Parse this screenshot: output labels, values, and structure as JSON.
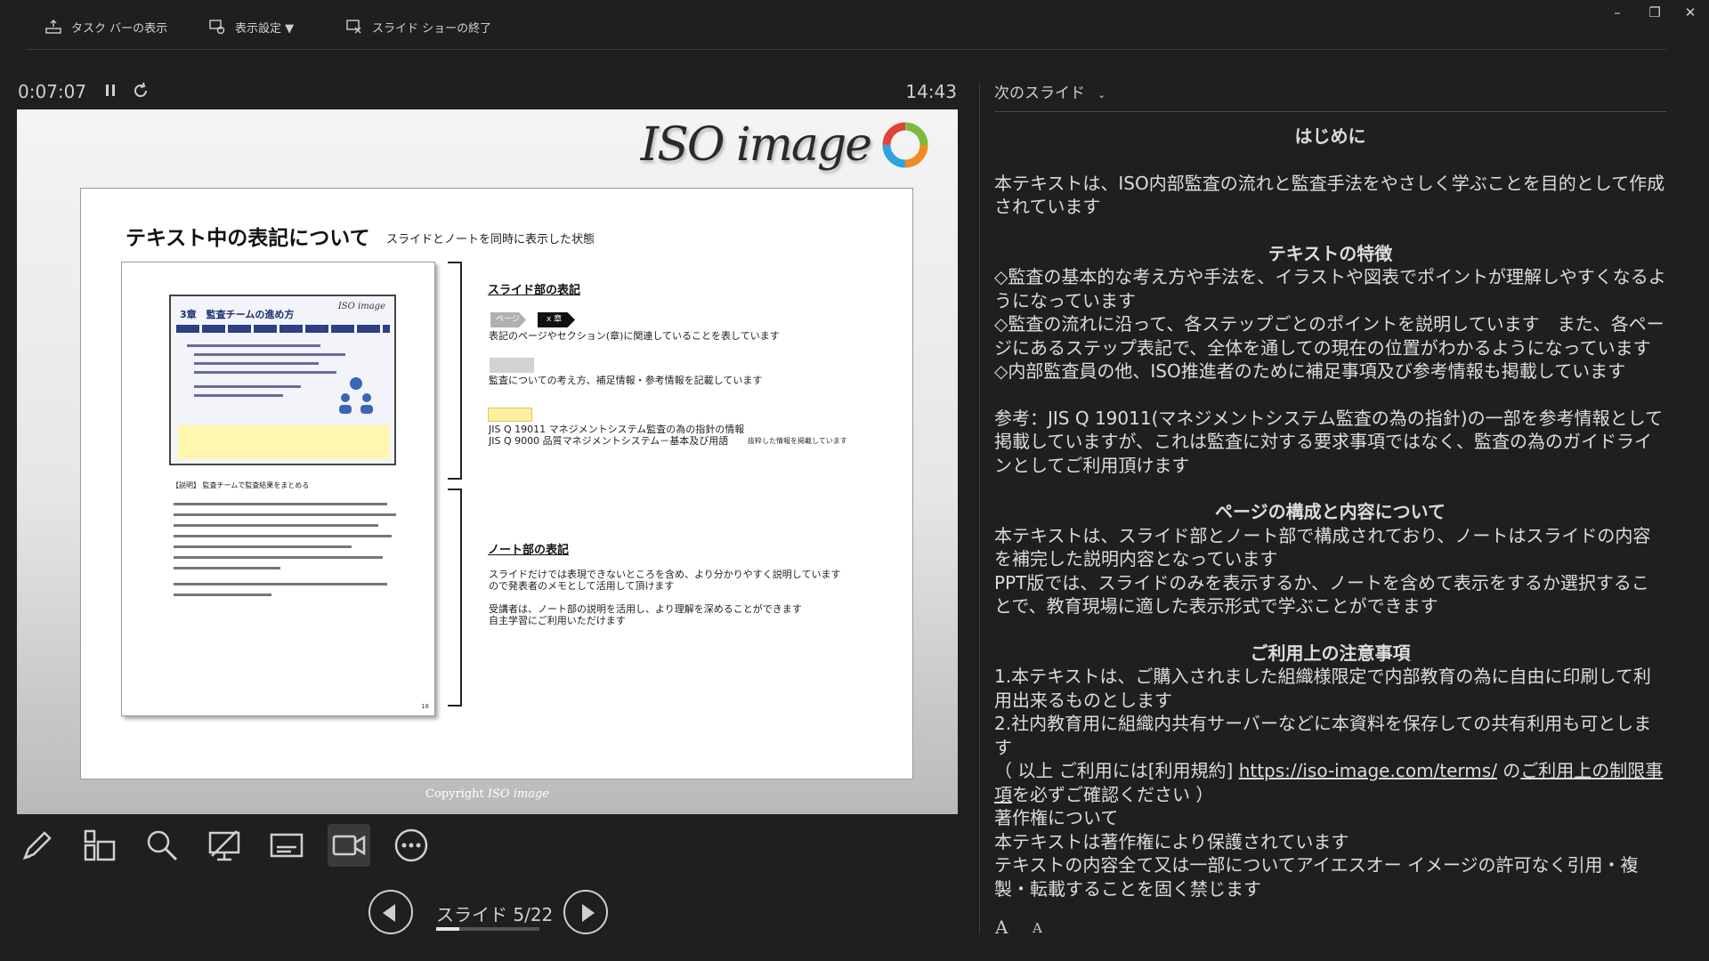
{
  "toolbar": {
    "taskbar_label": "タスク バーの表示",
    "display_settings_label": "表示設定 ▼",
    "end_show_label": "スライド ショーの終了"
  },
  "window": {
    "minimize": "–",
    "restore": "❐",
    "close": "✕"
  },
  "presenter": {
    "elapsed": "0:07:07",
    "clock": "14:43"
  },
  "slide": {
    "logo_text": "ISO image",
    "title": "テキスト中の表記について",
    "subtitle": "スライドとノートを同時に表示した状態",
    "thumb_title": "3章　監査チームの進め方",
    "thumb_logo": "ISO image",
    "doc_notes_title": "【説明】 監査チームで監査結果をまとめる",
    "doc_page_no": "18",
    "slide_section_heading": "スライド部の表記",
    "tag_page": "ページ",
    "tag_chapter": "x 章",
    "desc_tags": "表記のページやセクション(章)に関連していることを表しています",
    "desc_gray": "監査についての考え方、補足情報・参考情報を記載しています",
    "desc_yellow_1": "JIS Q 19011 マネジメントシステム監査の為の指針の情報",
    "desc_yellow_2": "JIS Q 9000  品質マネジメントシステム－基本及び用語",
    "side_note": "抜粋した情報を掲載しています",
    "note_section_heading": "ノート部の表記",
    "note_desc_1": "スライドだけでは表現できないところを含め、より分かりやすく説明しています",
    "note_desc_2": "ので発表者のメモとして活用して頂けます",
    "note_desc_3": "受講者は、ノート部の説明を活用し、より理解を深めることができます",
    "note_desc_4": "自主学習にご利用いただけます",
    "copyright_text": "Copyright",
    "copyright_logo": "ISO image"
  },
  "tools": [
    "pen-tool",
    "all-slides",
    "zoom",
    "black-screen",
    "subtitles",
    "camera",
    "more-options"
  ],
  "navigation": {
    "counter": "スライド 5/22",
    "progress": 0.227
  },
  "notes_panel": {
    "next_slide_label": "次のスライド",
    "heading_intro": "はじめに",
    "intro_text": "本テキストは、ISO内部監査の流れと監査手法をやさしく学ぶことを目的として作成されています",
    "heading_features": "テキストの特徴",
    "feature_1": "◇監査の基本的な考え方や手法を、イラストや図表でポイントが理解しやすくなるようになっています",
    "feature_2": "◇監査の流れに沿って、各ステップごとのポイントを説明しています　また、各ページにあるステップ表記で、全体を通しての現在の位置がわかるようになっています",
    "feature_3": "◇内部監査員の他、ISO推進者のために補足事項及び参考情報も掲載しています",
    "reference_text": "参考：JIS Q 19011(マネジメントシステム監査の為の指針)の一部を参考情報として掲載していますが、これは監査に対する要求事項ではなく、監査の為のガイドラインとしてご利用頂けます",
    "heading_structure": "ページの構成と内容について",
    "structure_text_1": "本テキストは、スライド部とノート部で構成されており、ノートはスライドの内容を補完した説明内容となっています",
    "structure_text_2": "PPT版では、スライドのみを表示するか、ノートを含めて表示をするか選択することで、教育現場に適した表示形式で学ぶことができます",
    "heading_usage": "ご利用上の注意事項",
    "usage_1": "1.本テキストは、ご購入されました組織様限定で内部教育の為に自由に印刷して利用出来るものとします",
    "usage_2": "2.社内教育用に組織内共有サーバーなどに本資料を保存しての共有利用も可とします",
    "terms_prefix": "（ 以上 ご利用には[利用規約] ",
    "terms_url": "https://iso-image.com/terms/",
    "terms_middle": " の",
    "terms_link2": "ご利用上の制限事項",
    "terms_suffix": "を必ずご確認ください ）",
    "copyright_heading": "著作権について",
    "copyright_1": "本テキストは著作権により保護されています",
    "copyright_2": "テキストの内容全て又は一部についてアイエスオー イメージの許可なく引用・複製・転載することを固く禁じます",
    "font_increase": "A",
    "font_decrease": "A"
  }
}
